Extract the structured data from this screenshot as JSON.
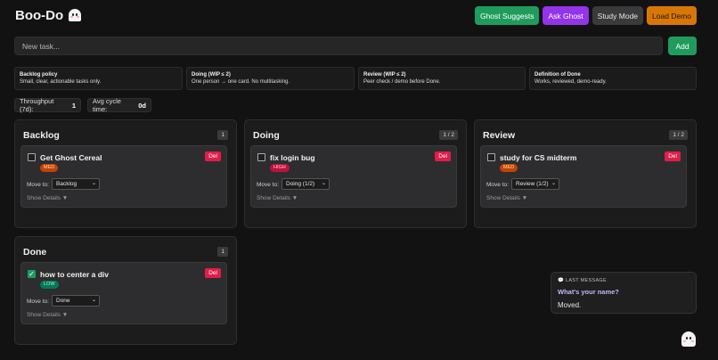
{
  "header": {
    "title": "Boo-Do",
    "buttons": {
      "ghost_suggests": "Ghost Suggests",
      "ask_ghost": "Ask Ghost",
      "study_mode": "Study Mode",
      "load_demo": "Load Demo"
    }
  },
  "new_task": {
    "placeholder": "New task...",
    "add_label": "Add"
  },
  "policies": [
    {
      "title": "Backlog policy",
      "text": "Small, clear, actionable tasks only."
    },
    {
      "title": "Doing (WIP ≤ 2)",
      "text": "One person → one card. No multitasking."
    },
    {
      "title": "Review (WIP ≤ 2)",
      "text": "Peer check / demo before Done."
    },
    {
      "title": "Definition of Done",
      "text": "Works, reviewed, demo-ready."
    }
  ],
  "stats": {
    "throughput_label": "Throughput (7d):",
    "throughput_value": "1",
    "cycle_label": "Avg cycle time:",
    "cycle_value": "0d"
  },
  "columns": {
    "backlog": {
      "title": "Backlog",
      "count": "1",
      "card": {
        "title": "Get Ghost Cereal",
        "priority": "MED",
        "delete": "Del",
        "move_label": "Move to:",
        "move_value": "Backlog",
        "details": "Show Details ▼",
        "done": false
      }
    },
    "doing": {
      "title": "Doing",
      "count": "1 / 2",
      "card": {
        "title": "fix login bug",
        "priority": "HIGH",
        "delete": "Del",
        "move_label": "Move to:",
        "move_value": "Doing (1/2)",
        "details": "Show Details ▼",
        "done": false
      }
    },
    "review": {
      "title": "Review",
      "count": "1 / 2",
      "card": {
        "title": "study for CS midterm",
        "priority": "MED",
        "delete": "Del",
        "move_label": "Move to:",
        "move_value": "Review (1/2)",
        "details": "Show Details ▼",
        "done": false
      }
    },
    "done": {
      "title": "Done",
      "count": "1",
      "card": {
        "title": "how to center a div",
        "priority": "LOW",
        "delete": "Del",
        "move_label": "Move to:",
        "move_value": "Done",
        "details": "Show Details ▼",
        "done": true
      }
    }
  },
  "last_message": {
    "label": "💬 LAST MESSAGE",
    "question": "What's your name?",
    "answer": "Moved."
  },
  "colors": {
    "green": "#1f9c5d",
    "purple": "#9333ea",
    "orange": "#d97706",
    "danger": "#e11d48",
    "background": "#121212"
  }
}
